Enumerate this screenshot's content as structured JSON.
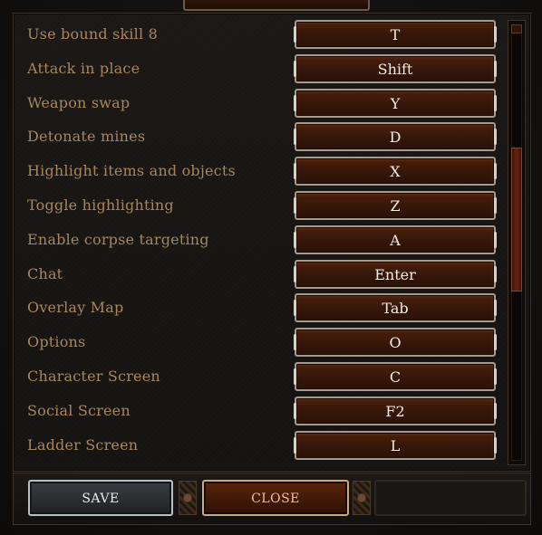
{
  "keybindings": [
    {
      "action": "Use bound skill 8",
      "key": "T"
    },
    {
      "action": "Attack in place",
      "key": "Shift"
    },
    {
      "action": "Weapon swap",
      "key": "Y"
    },
    {
      "action": "Detonate mines",
      "key": "D"
    },
    {
      "action": "Highlight items and objects",
      "key": "X"
    },
    {
      "action": "Toggle highlighting",
      "key": "Z"
    },
    {
      "action": "Enable corpse targeting",
      "key": "A"
    },
    {
      "action": "Chat",
      "key": "Enter"
    },
    {
      "action": "Overlay Map",
      "key": "Tab"
    },
    {
      "action": "Options",
      "key": "O"
    },
    {
      "action": "Character Screen",
      "key": "C"
    },
    {
      "action": "Social Screen",
      "key": "F2"
    },
    {
      "action": "Ladder Screen",
      "key": "L"
    }
  ],
  "scrollbar": {
    "position_fraction": 0.42,
    "visible_fraction": 0.33
  },
  "footer": {
    "save_label": "SAVE",
    "close_label": "CLOSE"
  },
  "colors": {
    "label_text": "#a8865a",
    "key_text": "#f2ede4",
    "key_button_fill": "#37170a",
    "close_text": "#f4c090"
  },
  "icons": [
    "ornament-divider-icon"
  ]
}
